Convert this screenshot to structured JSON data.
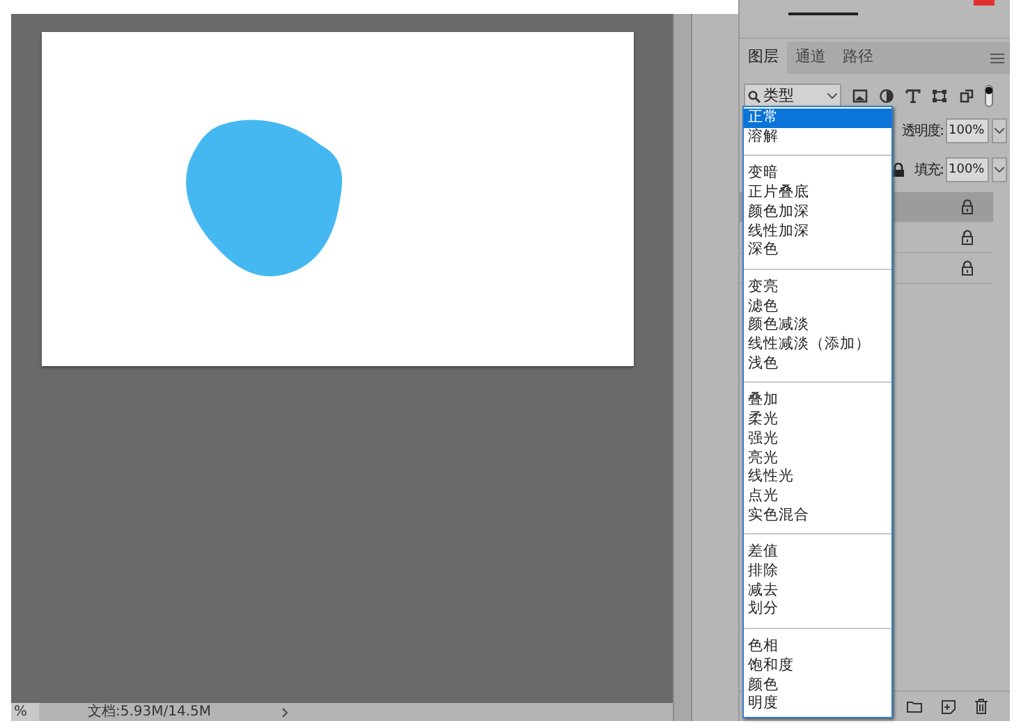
{
  "panel_tabs": [
    {
      "label": "图层",
      "selected": true
    },
    {
      "label": "通道",
      "selected": false
    },
    {
      "label": "路径",
      "selected": false
    }
  ],
  "filter": {
    "label": "类型"
  },
  "opacity": {
    "label": "透明度:",
    "value": "100%"
  },
  "fill": {
    "label": "填充:",
    "value": "100%"
  },
  "layers": [
    {
      "selected": true
    },
    {
      "selected": false
    },
    {
      "selected": false
    }
  ],
  "blend_menu": {
    "groups": [
      [
        {
          "label": "正常",
          "selected": true
        },
        {
          "label": "溶解",
          "selected": false
        }
      ],
      [
        {
          "label": "变暗",
          "selected": false
        },
        {
          "label": "正片叠底",
          "selected": false
        },
        {
          "label": "颜色加深",
          "selected": false
        },
        {
          "label": "线性加深",
          "selected": false
        },
        {
          "label": "深色",
          "selected": false
        }
      ],
      [
        {
          "label": "变亮",
          "selected": false
        },
        {
          "label": "滤色",
          "selected": false
        },
        {
          "label": "颜色减淡",
          "selected": false
        },
        {
          "label": "线性减淡（添加）",
          "selected": false
        },
        {
          "label": "浅色",
          "selected": false
        }
      ],
      [
        {
          "label": "叠加",
          "selected": false
        },
        {
          "label": "柔光",
          "selected": false
        },
        {
          "label": "强光",
          "selected": false
        },
        {
          "label": "亮光",
          "selected": false
        },
        {
          "label": "线性光",
          "selected": false
        },
        {
          "label": "点光",
          "selected": false
        },
        {
          "label": "实色混合",
          "selected": false
        }
      ],
      [
        {
          "label": "差值",
          "selected": false
        },
        {
          "label": "排除",
          "selected": false
        },
        {
          "label": "减去",
          "selected": false
        },
        {
          "label": "划分",
          "selected": false
        }
      ],
      [
        {
          "label": "色相",
          "selected": false
        },
        {
          "label": "饱和度",
          "selected": false
        },
        {
          "label": "颜色",
          "selected": false
        },
        {
          "label": "明度",
          "selected": false
        }
      ]
    ]
  },
  "status_bar": {
    "zoom": "%",
    "document": "文档:5.93M/14.5M"
  }
}
